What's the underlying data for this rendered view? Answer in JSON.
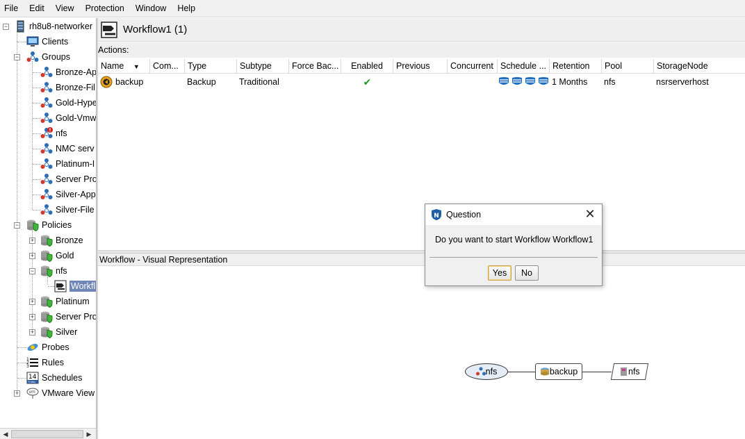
{
  "menu": [
    "File",
    "Edit",
    "View",
    "Protection",
    "Window",
    "Help"
  ],
  "tree": {
    "root": "rh8u8-networker",
    "clients": "Clients",
    "groups_label": "Groups",
    "groups": [
      "Bronze-Ap",
      "Bronze-Fil",
      "Gold-Hype",
      "Gold-Vmw",
      "nfs",
      "NMC serv",
      "Platinum-I",
      "Server Pro",
      "Silver-App",
      "Silver-File"
    ],
    "policies_label": "Policies",
    "policies": [
      "Bronze",
      "Gold",
      "nfs",
      "Platinum",
      "Server Pro",
      "Silver"
    ],
    "selected_workflow": "Workfl",
    "probes": "Probes",
    "rules": "Rules",
    "schedules": "Schedules",
    "schedules_icon_number": "14",
    "schedules_icon_text": "Friday",
    "vmware": "VMware View",
    "vmware_icon_text": "vm"
  },
  "workflow_title": "Workflow1 (1)",
  "actions_label": "Actions:",
  "table": {
    "columns": [
      "Name",
      "Com...",
      "Type",
      "Subtype",
      "Force Bac...",
      "Enabled",
      "Previous",
      "Concurrent",
      "Schedule ...",
      "Retention",
      "Pool",
      "StorageNode"
    ],
    "sort_indicator": "▼",
    "row": {
      "name": "backup",
      "type": "Backup",
      "subtype": "Traditional",
      "enabled": "✔",
      "retention": "1 Months",
      "pool": "nfs",
      "storage_node": "nsrserverhost"
    }
  },
  "visual_title": "Workflow - Visual Representation",
  "diagram": {
    "group_node": "nfs",
    "action_node": "backup",
    "pool_node": "nfs"
  },
  "dialog": {
    "title": "Question",
    "icon_letter": "N",
    "message": "Do you want to start Workflow Workflow1",
    "yes": "Yes",
    "no": "No",
    "close": "✕"
  },
  "colors": {
    "selection": "#6f87b6",
    "shield_green": "#3fb53a",
    "group_blue": "#2c6fb8",
    "group_red": "#d43a2c",
    "check_green": "#1f9a2a"
  }
}
